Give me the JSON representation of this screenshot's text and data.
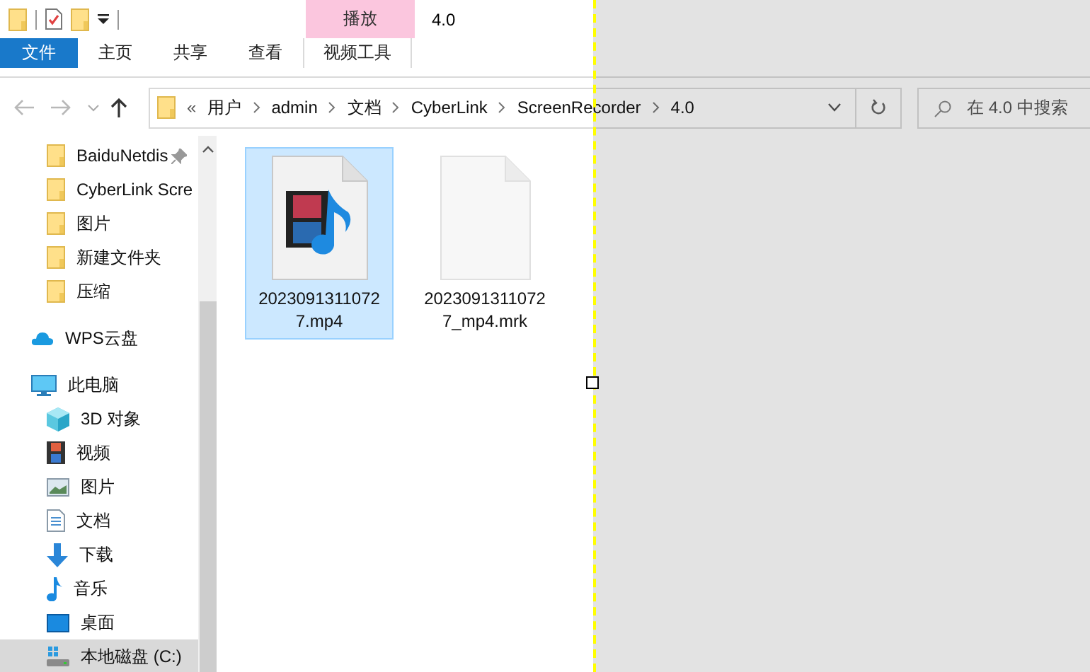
{
  "quick_access_toolbar": {
    "title": "4.0"
  },
  "ribbon": {
    "context_group": "播放",
    "tabs": [
      {
        "label": "文件",
        "kind": "file",
        "selected": false
      },
      {
        "label": "主页",
        "kind": "normal",
        "selected": false
      },
      {
        "label": "共享",
        "kind": "normal",
        "selected": false
      },
      {
        "label": "查看",
        "kind": "normal",
        "selected": false
      },
      {
        "label": "视频工具",
        "kind": "context",
        "selected": false
      }
    ]
  },
  "navigation": {
    "back": {
      "disabled": true
    },
    "forward": {
      "disabled": true
    },
    "up": {
      "disabled": false
    }
  },
  "address_bar": {
    "overflow": "«",
    "path": [
      "用户",
      "admin",
      "文档",
      "CyberLink",
      "ScreenRecorder",
      "4.0"
    ]
  },
  "search": {
    "placeholder": "在 4.0 中搜索"
  },
  "sidebar": {
    "quick_access": [
      {
        "label": "BaiduNetdis",
        "kind": "folder",
        "pinned": true,
        "selected": false
      },
      {
        "label": "CyberLink Scre",
        "kind": "folder",
        "pinned": false,
        "selected": false
      },
      {
        "label": "图片",
        "kind": "folder",
        "pinned": false,
        "selected": false
      },
      {
        "label": "新建文件夹",
        "kind": "folder",
        "pinned": false,
        "selected": false
      },
      {
        "label": "压缩",
        "kind": "folder",
        "pinned": false,
        "selected": false
      }
    ],
    "items": [
      {
        "label": "WPS云盘",
        "kind": "cloud",
        "selected": false
      },
      {
        "label": "此电脑",
        "kind": "pc",
        "selected": false,
        "children": [
          {
            "label": "3D 对象",
            "kind": "cube",
            "selected": false
          },
          {
            "label": "视频",
            "kind": "film",
            "selected": false
          },
          {
            "label": "图片",
            "kind": "picture",
            "selected": false
          },
          {
            "label": "文档",
            "kind": "doc",
            "selected": false
          },
          {
            "label": "下载",
            "kind": "download",
            "selected": false
          },
          {
            "label": "音乐",
            "kind": "music",
            "selected": false
          },
          {
            "label": "桌面",
            "kind": "desktop",
            "selected": false
          },
          {
            "label": "本地磁盘 (C:)",
            "kind": "drive",
            "selected": true
          }
        ]
      }
    ]
  },
  "files": [
    {
      "name": "20230913110727.mp4",
      "kind": "video",
      "selected": true
    },
    {
      "name": "20230913110727_mp4.mrk",
      "kind": "blank",
      "selected": false
    }
  ]
}
